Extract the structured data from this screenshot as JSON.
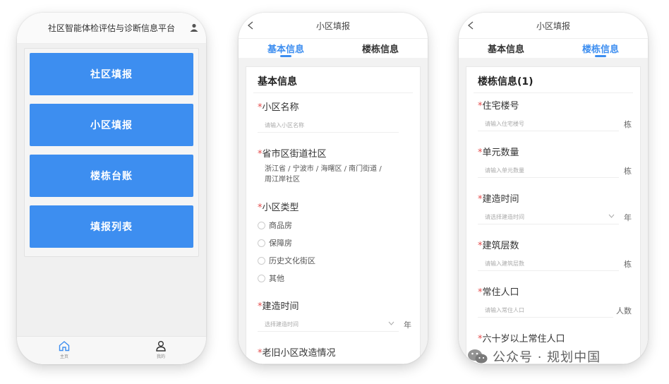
{
  "screen1": {
    "header_title": "社区智能体检评估与诊断信息平台",
    "menu": [
      "社区填报",
      "小区填报",
      "楼栋台账",
      "填报列表"
    ],
    "tabbar": {
      "home_label": "主页",
      "mine_label": "我的"
    }
  },
  "screen2": {
    "nav_title": "小区填报",
    "tabs": [
      "基本信息",
      "楼栋信息"
    ],
    "active_tab": "基本信息",
    "section_title": "基本信息",
    "fields": {
      "name": {
        "label": "小区名称",
        "placeholder": "请输入小区名称"
      },
      "region": {
        "label": "省市区街道社区",
        "value_line1": "浙江省 / 宁波市 / 海曙区 / 南门街道 /",
        "value_line2": "周江岸社区"
      },
      "type": {
        "label": "小区类型",
        "options": [
          "商品房",
          "保障房",
          "历史文化街区",
          "其他"
        ]
      },
      "build_time": {
        "label": "建造时间",
        "placeholder": "选择建造时间",
        "unit": "年"
      },
      "renovation": {
        "label": "老旧小区改造情况"
      }
    },
    "required_mark": "*"
  },
  "screen3": {
    "nav_title": "小区填报",
    "tabs": [
      "基本信息",
      "楼栋信息"
    ],
    "active_tab": "楼栋信息",
    "section_title": "楼栋信息(1)",
    "fields": [
      {
        "label": "住宅楼号",
        "placeholder": "请输入住宅楼号",
        "unit": "栋"
      },
      {
        "label": "单元数量",
        "placeholder": "请输入单元数量",
        "unit": "栋"
      },
      {
        "label": "建造时间",
        "placeholder": "请选择建造时间",
        "unit": "年"
      },
      {
        "label": "建筑层数",
        "placeholder": "请输入建筑层数",
        "unit": "栋"
      },
      {
        "label": "常住人口",
        "placeholder": "请输入常住人口",
        "unit": "人数"
      },
      {
        "label": "六十岁以上常住人口"
      }
    ]
  },
  "watermark": "公众号 · 规划中国",
  "colors": {
    "primary": "#3d8ef0",
    "required": "#e54c4c"
  }
}
